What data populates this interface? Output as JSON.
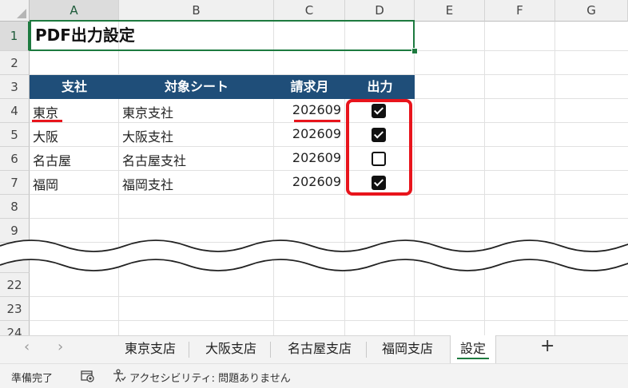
{
  "columns": [
    "A",
    "B",
    "C",
    "D",
    "E",
    "F",
    "G"
  ],
  "rows": [
    "1",
    "2",
    "3",
    "4",
    "5",
    "6",
    "7",
    "8",
    "9",
    "22",
    "23",
    "24"
  ],
  "title": "PDF出力設定",
  "headers": {
    "branch": "支社",
    "sheet": "対象シート",
    "month": "請求月",
    "output": "出力"
  },
  "table": [
    {
      "branch": "東京",
      "sheet": "東京支社",
      "month": "202609",
      "output": true
    },
    {
      "branch": "大阪",
      "sheet": "大阪支社",
      "month": "202609",
      "output": true
    },
    {
      "branch": "名古屋",
      "sheet": "名古屋支社",
      "month": "202609",
      "output": false
    },
    {
      "branch": "福岡",
      "sheet": "福岡支社",
      "month": "202609",
      "output": true
    }
  ],
  "tabs": [
    "東京支店",
    "大阪支店",
    "名古屋支店",
    "福岡支店",
    "設定"
  ],
  "active_tab": "設定",
  "nav": {
    "prev": "‹",
    "next": "›",
    "add": "+"
  },
  "status": {
    "ready": "準備完了",
    "accessibility": "アクセシビリティ: 問題ありません"
  },
  "colors": {
    "header_fill": "#1f4e79",
    "highlight": "#e8141c",
    "selection": "#1d7a3f"
  }
}
